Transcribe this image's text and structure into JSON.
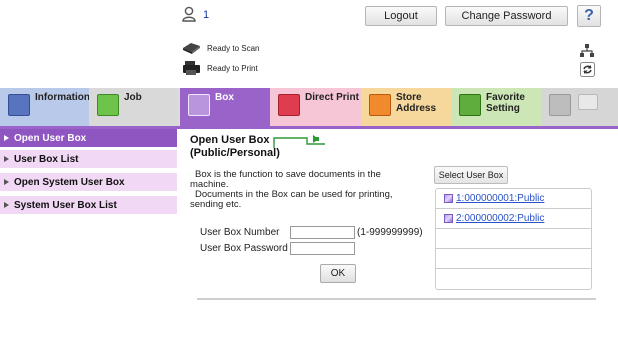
{
  "header": {
    "user_count": "1",
    "logout_label": "Logout",
    "change_password_label": "Change Password",
    "help_label": "?"
  },
  "status": {
    "scan": "Ready to Scan",
    "print": "Ready to Print"
  },
  "tabs": [
    {
      "label": "Information",
      "icon": "information-icon"
    },
    {
      "label": "Job",
      "icon": "job-icon"
    },
    {
      "label": "Box",
      "icon": "box-icon"
    },
    {
      "label": "Direct Print",
      "icon": "direct-print-icon"
    },
    {
      "label": "Store Address",
      "icon": "store-address-icon"
    },
    {
      "label": "Favorite Setting",
      "icon": "favorite-setting-icon"
    }
  ],
  "tab_lines": {
    "store": [
      "Store",
      "Address"
    ],
    "favorite": [
      "Favorite",
      "Setting"
    ]
  },
  "sidebar": {
    "items": [
      {
        "label": "Open User Box",
        "active": true
      },
      {
        "label": "User Box List",
        "active": false
      },
      {
        "label": "Open System User Box",
        "active": false
      },
      {
        "label": "System User Box List",
        "active": false
      }
    ]
  },
  "main": {
    "title_line1": "Open User Box",
    "title_line2": "(Public/Personal)",
    "desc_line1": "Box is the function to save documents in the",
    "desc_line2": "machine.",
    "desc_line3": "Documents in the Box can be used for printing,",
    "desc_line4": "sending etc.",
    "number_label": "User Box Number",
    "number_value": "",
    "number_range": "(1-999999999)",
    "password_label": "User Box Password",
    "password_value": "",
    "ok_label": "OK",
    "select_label": "Select User Box",
    "boxes": [
      "1:000000001:Public",
      "2:000000002:Public"
    ]
  },
  "colors": {
    "active_tab": "#9a63c9",
    "sidebar_active": "#8f56c2",
    "sidebar_item": "#f1d8f4",
    "tab_bar": "#dcdcdc",
    "link": "#2b53c8"
  }
}
